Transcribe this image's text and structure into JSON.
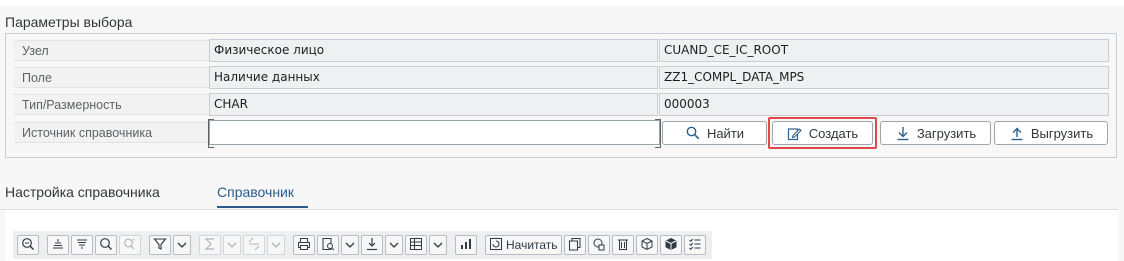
{
  "section": {
    "title": "Параметры выбора"
  },
  "rows": [
    {
      "label": "Узел",
      "value": "Физическое лицо",
      "code": "CUAND_CE_IC_ROOT"
    },
    {
      "label": "Поле",
      "value": "Наличие данных",
      "code": "ZZ1_COMPL_DATA_MPS"
    },
    {
      "label": "Тип/Размерность",
      "value": "CHAR",
      "code": "000003"
    }
  ],
  "source": {
    "label": "Источник справочника",
    "value": ""
  },
  "buttons": {
    "find": "Найти",
    "create": "Создать",
    "upload": "Загрузить",
    "download": "Выгрузить"
  },
  "tabs": [
    {
      "label": "Настройка справочника"
    },
    {
      "label": "Справочник"
    }
  ],
  "toolbar": {
    "start_label": "Начитать"
  },
  "colors": {
    "accent": "#2a5d8c",
    "highlight": "#e0474c"
  }
}
